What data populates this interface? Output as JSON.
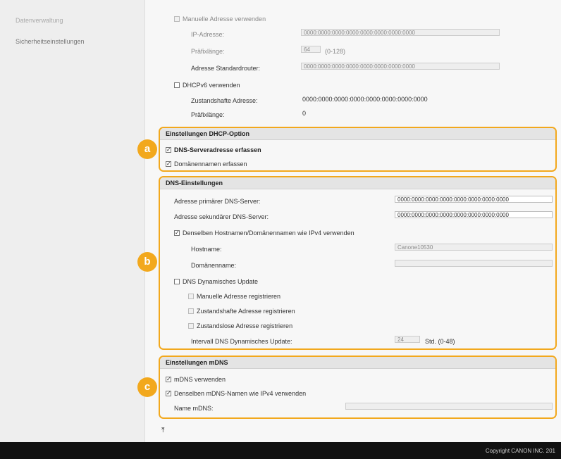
{
  "sidebar": {
    "items": [
      {
        "label": "Datenverwaltung"
      },
      {
        "label": "Sicherheitseinstellungen"
      }
    ]
  },
  "top": {
    "manual_addr_label": "Manuelle Adresse verwenden",
    "ip_label": "IP-Adresse:",
    "ip_value": "0000:0000:0000:0000:0000:0000:0000:0000",
    "prefix_label": "Präfixlänge:",
    "prefix_value": "64",
    "prefix_range": "(0-128)",
    "gateway_label": "Adresse Standardrouter:",
    "gateway_value": "0000:0000:0000:0000:0000:0000:0000:0000",
    "dhcpv6_label": "DHCPv6 verwenden",
    "stateful_label": "Zustandshafte Adresse:",
    "stateful_value": "0000:0000:0000:0000:0000:0000:0000:0000",
    "prefix2_label": "Präfixlänge:",
    "prefix2_value": "0"
  },
  "section_a": {
    "badge": "a",
    "title": "Einstellungen DHCP-Option",
    "dns_server_label": "DNS-Serveradresse erfassen",
    "domain_label": "Domänennamen erfassen"
  },
  "section_b": {
    "badge": "b",
    "title": "DNS-Einstellungen",
    "primary_label": "Adresse primärer DNS-Server:",
    "primary_value": "0000:0000:0000:0000:0000:0000:0000:0000",
    "secondary_label": "Adresse sekundärer DNS-Server:",
    "secondary_value": "0000:0000:0000:0000:0000:0000:0000:0000",
    "same_host_label": "Denselben Hostnamen/Domänennamen wie IPv4 verwenden",
    "hostname_label": "Hostname:",
    "hostname_value": "Canone10530",
    "domain_label": "Domänenname:",
    "domain_value": "",
    "dyn_update_label": "DNS Dynamisches Update",
    "reg_manual_label": "Manuelle Adresse registrieren",
    "reg_stateful_label": "Zustandshafte Adresse registrieren",
    "reg_stateless_label": "Zustandslose Adresse registrieren",
    "interval_label": "Intervall DNS Dynamisches Update:",
    "interval_value": "24",
    "interval_unit": "Std. (0-48)"
  },
  "section_c": {
    "badge": "c",
    "title": "Einstellungen mDNS",
    "use_mdns_label": "mDNS verwenden",
    "same_name_label": "Denselben mDNS-Namen wie IPv4 verwenden",
    "name_label": "Name mDNS:",
    "name_value": ""
  },
  "nav": {
    "top_glyph": "⤒"
  },
  "footer": {
    "copyright": "Copyright CANON INC. 201"
  },
  "colors": {
    "accent": "#f2a81d",
    "footer_bg": "#111111"
  }
}
